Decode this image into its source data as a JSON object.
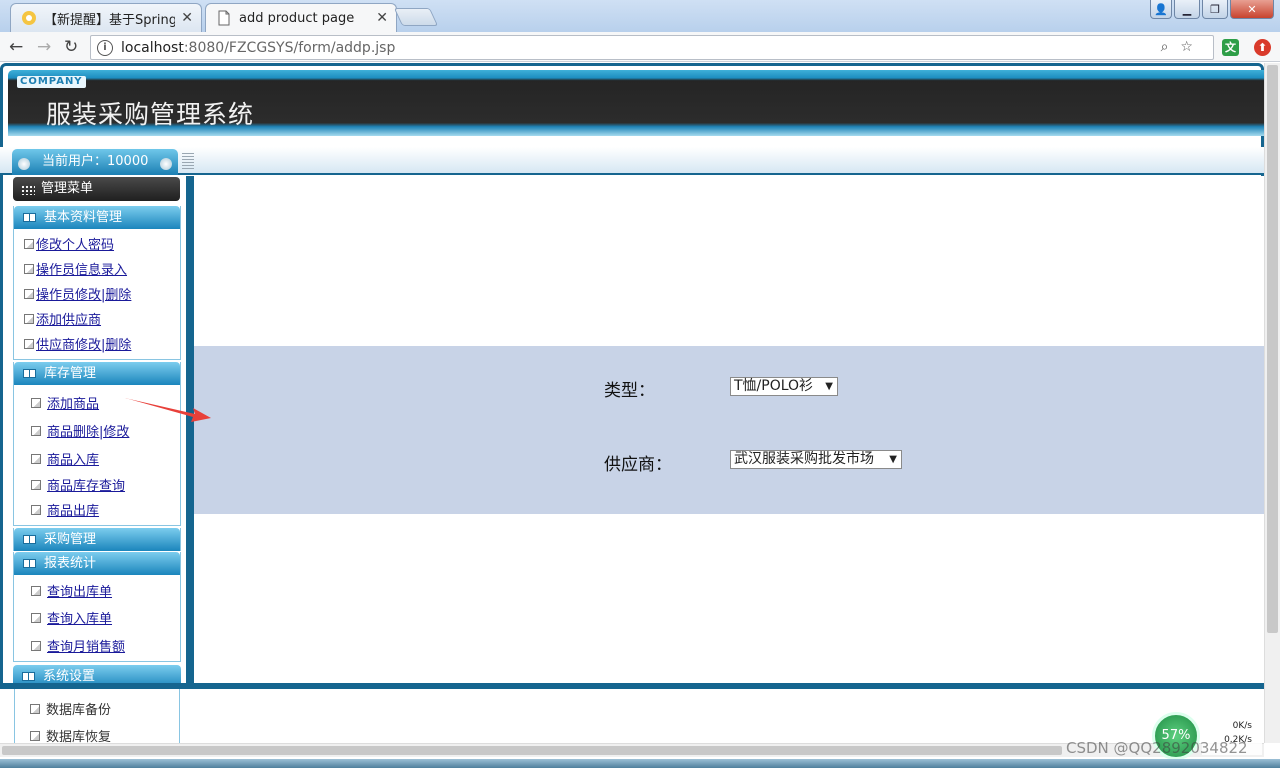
{
  "browser": {
    "tabs": [
      {
        "label": "【新提醒】基于SpringM",
        "active": false
      },
      {
        "label": "add product page",
        "active": true
      }
    ],
    "url_host": "localhost",
    "url_path": ":8080/FZCGSYS/form/addp.jsp"
  },
  "header": {
    "company": "COMPANY",
    "title": "服装采购管理系统",
    "current_user": "当前用户：10000"
  },
  "sidebar": {
    "menu_title": "管理菜单",
    "sections": [
      {
        "title": "基本资料管理",
        "items": [
          "修改个人密码",
          "操作员信息录入",
          "操作员修改|删除",
          "添加供应商",
          "供应商修改|删除"
        ]
      },
      {
        "title": "库存管理",
        "items": [
          "添加商品",
          "商品删除|修改",
          "商品入库",
          "商品库存查询",
          "商品出库"
        ]
      },
      {
        "title": "采购管理",
        "items": []
      },
      {
        "title": "报表统计",
        "items": [
          "查询出库单",
          "查询入库单",
          "查询月销售额"
        ]
      },
      {
        "title": "系统设置",
        "items": [
          "数据库备份",
          "数据库恢复"
        ]
      }
    ]
  },
  "form": {
    "type_label": "类型：",
    "type_value": "T恤/POLO衫",
    "supplier_label": "供应商：",
    "supplier_value": "武汉服装采购批发市场"
  },
  "overlay": {
    "net_percent": "57%",
    "net_up": "0K/s",
    "net_down": "0.2K/s",
    "watermark": "CSDN @QQ2892034822"
  },
  "colors": {
    "frame_blue": "#15658f",
    "form_band": "#c8d3e7",
    "arrow_red": "#e8403a"
  }
}
